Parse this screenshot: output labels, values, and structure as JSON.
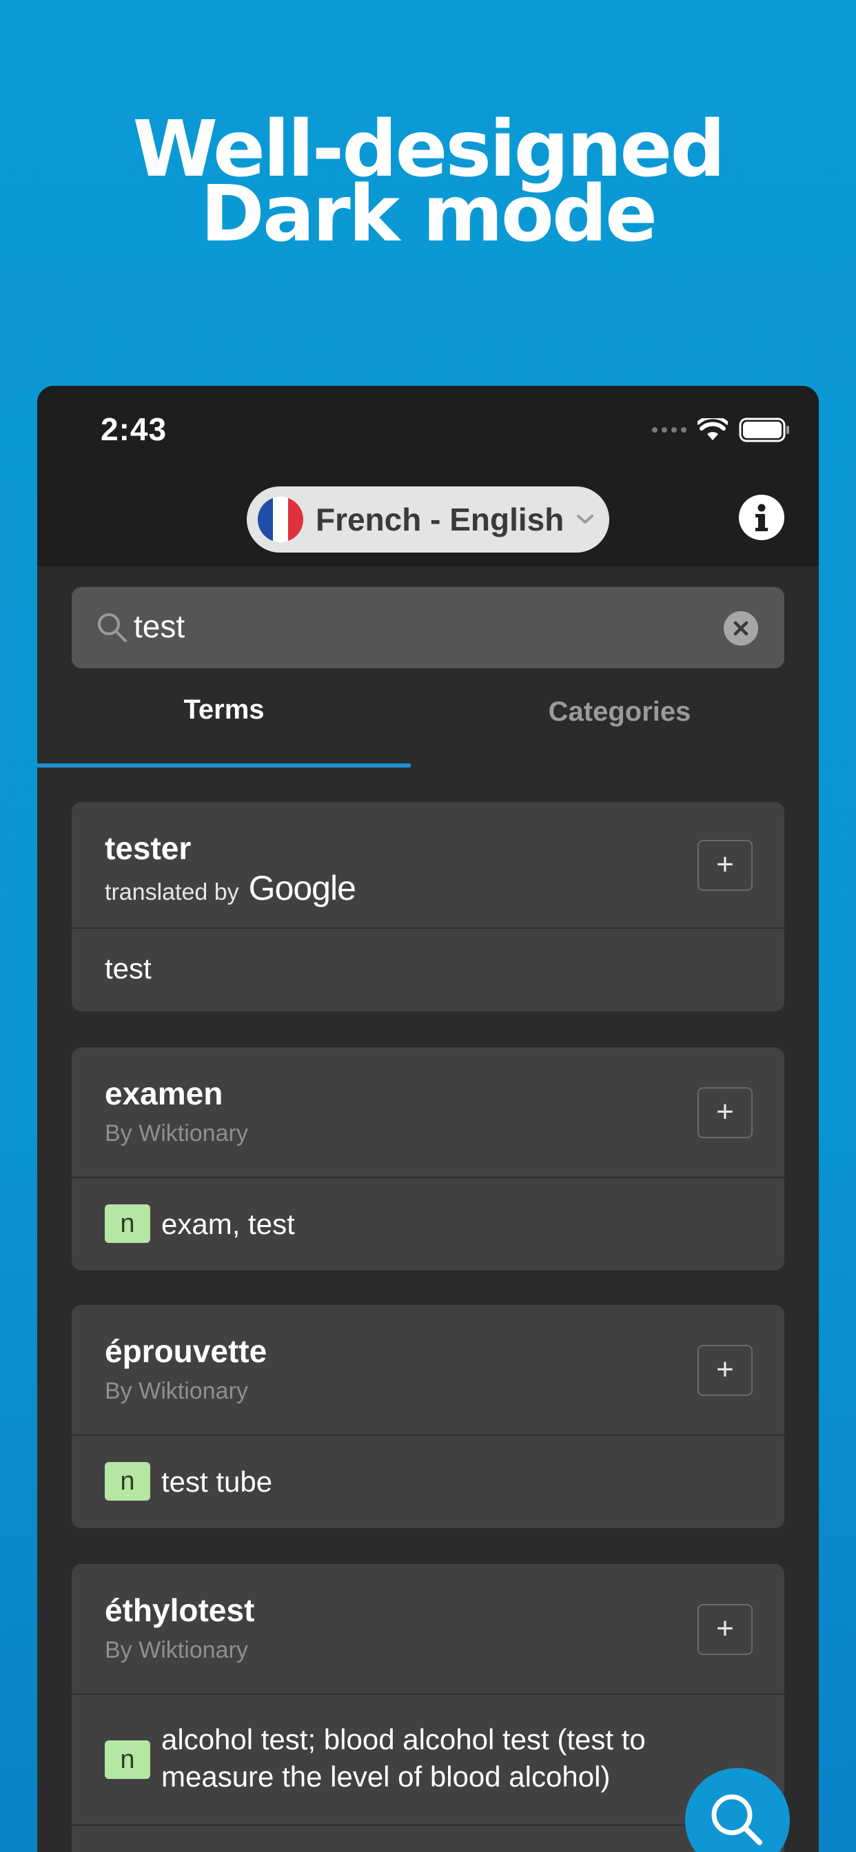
{
  "promo": {
    "line1": "Well-designed",
    "line2": "Dark mode"
  },
  "status_bar": {
    "time": "2:43"
  },
  "header": {
    "language_pair": "French - English"
  },
  "search": {
    "value": "test"
  },
  "tabs": [
    {
      "label": "Terms",
      "active": true
    },
    {
      "label": "Categories",
      "active": false
    }
  ],
  "results": [
    {
      "term": "tester",
      "source_prefix": "translated by",
      "source_brand": "Google",
      "translation": "test"
    },
    {
      "term": "examen",
      "source": "By Wiktionary",
      "pos": "n",
      "translation": "exam, test"
    },
    {
      "term": "éprouvette",
      "source": "By Wiktionary",
      "pos": "n",
      "translation": "test tube"
    },
    {
      "term": "éthylotest",
      "source": "By Wiktionary",
      "pos": "n",
      "translation_line1": "alcohol test; blood alcohol test (test to",
      "translation_line2": "measure the level of blood alcohol)"
    }
  ],
  "add_label": "+",
  "colors": {
    "background": "#0a94d3",
    "accent": "#1c8fd0",
    "card": "#414141",
    "pos_badge": "#b5e6a4"
  },
  "icons": [
    "france-flag-icon",
    "chevron-down-icon",
    "info-icon",
    "search-icon",
    "clear-icon",
    "wifi-icon",
    "battery-icon",
    "signal-icon"
  ]
}
